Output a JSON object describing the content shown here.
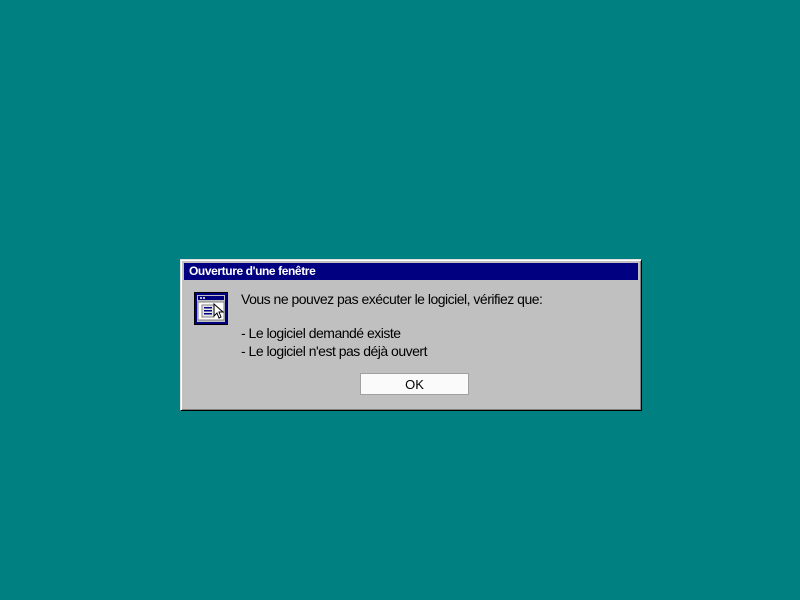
{
  "desktop": {
    "background_color": "#008080"
  },
  "dialog": {
    "title": "Ouverture d'une fenêtre",
    "icon": "application-window-icon",
    "message": "Vous ne pouvez pas exécuter le logiciel, vérifiez que:",
    "bullets": [
      "- Le logiciel demandé existe",
      "- Le logiciel n'est pas déjà ouvert"
    ],
    "ok_label": "OK",
    "titlebar_color": "#000080",
    "face_color": "#c0c0c0"
  }
}
